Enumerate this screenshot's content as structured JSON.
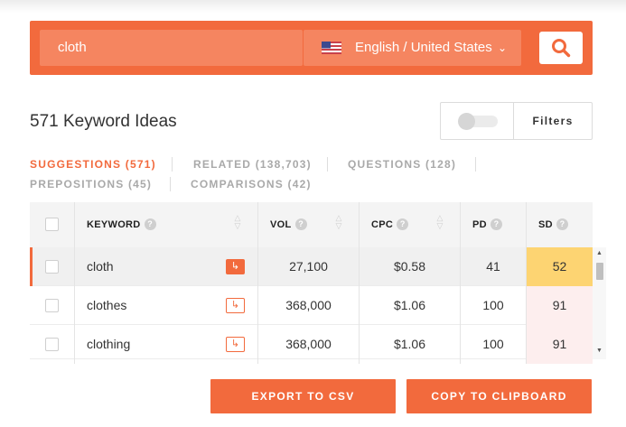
{
  "search": {
    "query": "cloth",
    "language": "English / United States"
  },
  "header": {
    "title": "571 Keyword Ideas",
    "filters_label": "Filters"
  },
  "tabs": [
    {
      "label": "SUGGESTIONS (571)",
      "active": true
    },
    {
      "label": "RELATED (138,703)",
      "active": false
    },
    {
      "label": "QUESTIONS (128)",
      "active": false
    },
    {
      "label": "PREPOSITIONS (45)",
      "active": false
    },
    {
      "label": "COMPARISONS (42)",
      "active": false
    }
  ],
  "table": {
    "columns": {
      "keyword": "KEYWORD",
      "vol": "VOL",
      "cpc": "CPC",
      "pd": "PD",
      "sd": "SD"
    },
    "help_glyph": "?",
    "rows": [
      {
        "keyword": "cloth",
        "vol": "27,100",
        "cpc": "$0.58",
        "pd": "41",
        "sd": "52",
        "sd_color": "#fdd472",
        "selected": true
      },
      {
        "keyword": "clothes",
        "vol": "368,000",
        "cpc": "$1.06",
        "pd": "100",
        "sd": "91",
        "sd_color": "#fdeeee",
        "selected": false
      },
      {
        "keyword": "clothing",
        "vol": "368,000",
        "cpc": "$1.06",
        "pd": "100",
        "sd": "91",
        "sd_color": "#fdeeee",
        "selected": false
      }
    ]
  },
  "actions": {
    "export_label": "EXPORT TO CSV",
    "copy_label": "COPY TO CLIPBOARD"
  },
  "colors": {
    "accent": "#f26a3d"
  },
  "icons": {
    "search": "search-icon",
    "flag": "us-flag-icon",
    "open": "open-keyword-icon",
    "sort": "sort-icon"
  }
}
